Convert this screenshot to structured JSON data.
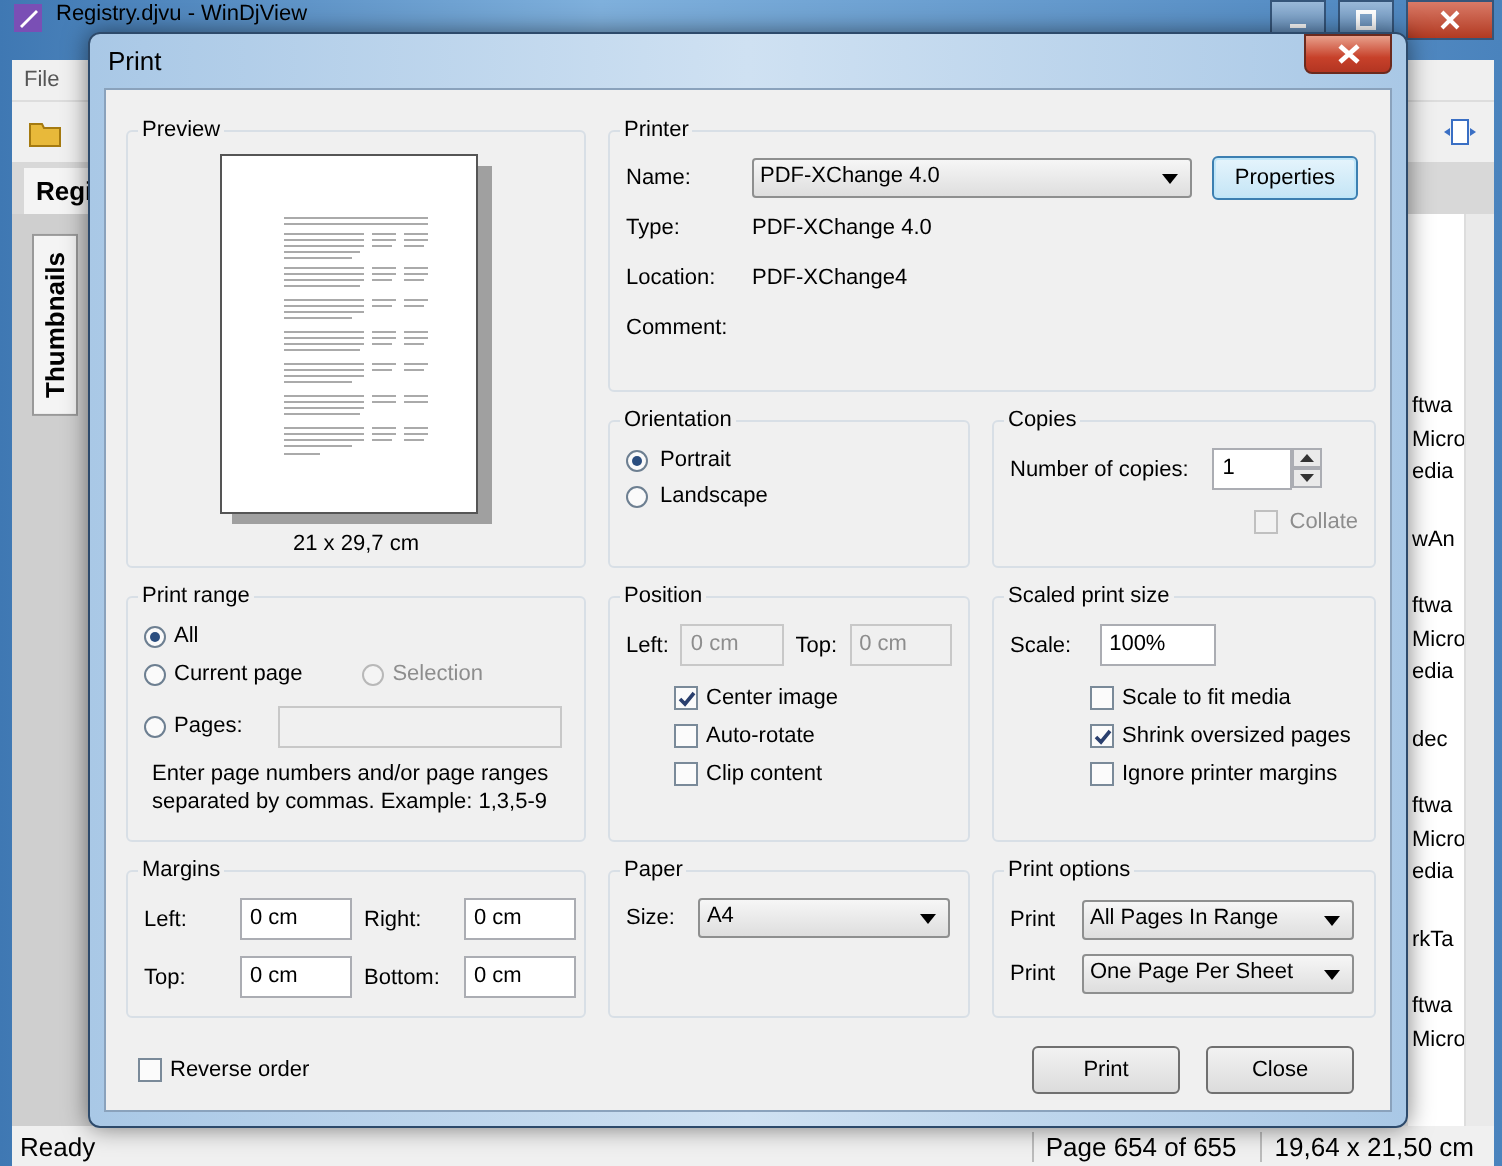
{
  "background_window": {
    "title": "Registry.djvu - WinDjView",
    "menu": [
      "File"
    ],
    "tab": "Regi",
    "side_tab": "Thumbnails",
    "list_fragments": [
      [
        "ftwa",
        "Micro",
        "edia"
      ],
      [
        "wAn"
      ],
      [
        "ftwa",
        "Micro",
        "edia"
      ],
      [
        "dec"
      ],
      [
        "ftwa",
        "Micro",
        "edia"
      ],
      [
        "rkTa"
      ],
      [
        "ftwa",
        "Micro"
      ]
    ],
    "status_bar": [
      "Ready",
      "Page 654 of 655",
      "19,64 x 21,50 cm"
    ]
  },
  "dialog": {
    "title": "Print",
    "preview": {
      "title": "Preview",
      "paper_size": "21 x 29,7 cm"
    },
    "printer": {
      "title": "Printer",
      "name_label": "Name:",
      "name": "PDF-XChange 4.0",
      "properties_button": "Properties",
      "type_label": "Type:",
      "type": "PDF-XChange 4.0",
      "location_label": "Location:",
      "location": "PDF-XChange4",
      "comment_label": "Comment:"
    },
    "orientation": {
      "title": "Orientation",
      "options": [
        {
          "label": "Portrait",
          "selected": true
        },
        {
          "label": "Landscape",
          "selected": false
        }
      ]
    },
    "copies": {
      "title": "Copies",
      "label": "Number of copies:",
      "value": "1",
      "collate": {
        "label": "Collate",
        "checked": false,
        "disabled": true
      }
    },
    "print_range": {
      "title": "Print range",
      "options": [
        {
          "label": "All",
          "selected": true,
          "disabled": false
        },
        {
          "label": "Current page",
          "selected": false,
          "disabled": false
        },
        {
          "label": "Selection",
          "selected": false,
          "disabled": true
        },
        {
          "label": "Pages:",
          "selected": false,
          "disabled": false
        }
      ],
      "pages_field": {
        "disabled": true
      },
      "hint": "Enter page numbers and/or page ranges separated by commas. Example: 1,3,5-9"
    },
    "position": {
      "title": "Position",
      "left_label": "Left:",
      "left": "0 cm",
      "top_label": "Top:",
      "top": "0 cm",
      "fields_disabled": true,
      "options": [
        {
          "label": "Center image",
          "checked": true
        },
        {
          "label": "Auto-rotate",
          "checked": false
        },
        {
          "label": "Clip content",
          "checked": false
        }
      ]
    },
    "scaled_print_size": {
      "title": "Scaled print size",
      "scale_label": "Scale:",
      "scale": "100%",
      "options": [
        {
          "label": "Scale to fit media",
          "checked": false
        },
        {
          "label": "Shrink oversized pages",
          "checked": true
        },
        {
          "label": "Ignore printer margins",
          "checked": false
        }
      ]
    },
    "margins": {
      "title": "Margins",
      "fields": [
        {
          "label": "Left:",
          "value": "0 cm"
        },
        {
          "label": "Right:",
          "value": "0 cm"
        },
        {
          "label": "Top:",
          "value": "0 cm"
        },
        {
          "label": "Bottom:",
          "value": "0 cm"
        }
      ]
    },
    "paper": {
      "title": "Paper",
      "size_label": "Size:",
      "size": "A4"
    },
    "print_options": {
      "title": "Print options",
      "rows": [
        {
          "label": "Print",
          "value": "All Pages In Range"
        },
        {
          "label": "Print",
          "value": "One Page Per Sheet"
        }
      ]
    },
    "reverse_order": {
      "label": "Reverse order",
      "checked": false
    },
    "buttons": [
      "Print",
      "Close"
    ]
  }
}
